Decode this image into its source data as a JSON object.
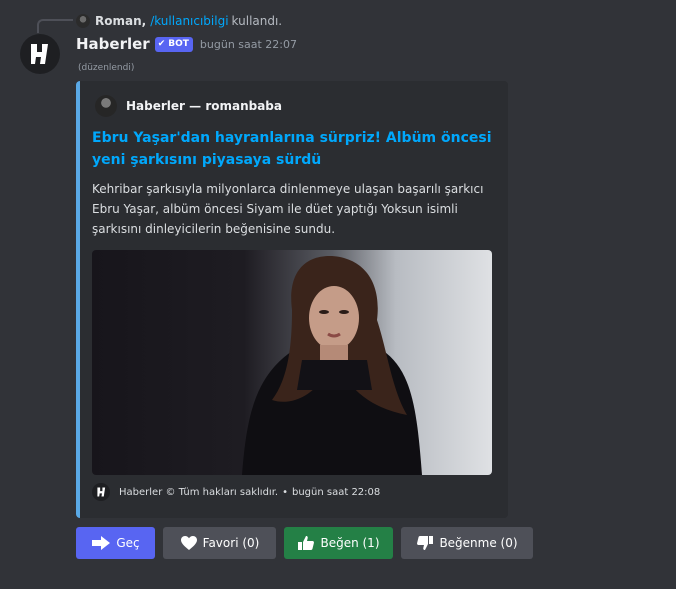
{
  "reply": {
    "user": "Roman,",
    "command": "/kullanıcıbilgi",
    "used_text": "kullandı."
  },
  "message": {
    "author": "Haberler",
    "bot_badge": "BOT",
    "timestamp": "bugün saat 22:07",
    "edited": "(düzenlendi)"
  },
  "embed": {
    "accent_color": "#5aa9e6",
    "author": "Haberler — romanbaba",
    "title": "Ebru Yaşar'dan hayranlarına sürpriz! Albüm öncesi yeni şarkısını piyasaya sürdü",
    "description": "Kehribar şarkısıyla milyonlarca dinlenmeye ulaşan başarılı şarkıcı Ebru Yaşar, albüm öncesi Siyam ile düet yaptığı Yoksun isimli şarkısını dinleyicilerin beğenisine sundu.",
    "footer": {
      "text": "Haberler © Tüm hakları saklıdır.",
      "separator": "•",
      "timestamp": "bugün saat 22:08"
    }
  },
  "buttons": [
    {
      "label": "Geç",
      "icon": "arrow-right-icon",
      "style": "primary",
      "color": "#5865f2"
    },
    {
      "label": "Favori (0)",
      "icon": "heart-icon",
      "style": "secondary",
      "color": "#4e5058"
    },
    {
      "label": "Beğen (1)",
      "icon": "thumbs-up-icon",
      "style": "success",
      "color": "#248046"
    },
    {
      "label": "Beğenme (0)",
      "icon": "thumbs-down-icon",
      "style": "secondary",
      "color": "#4e5058"
    }
  ]
}
